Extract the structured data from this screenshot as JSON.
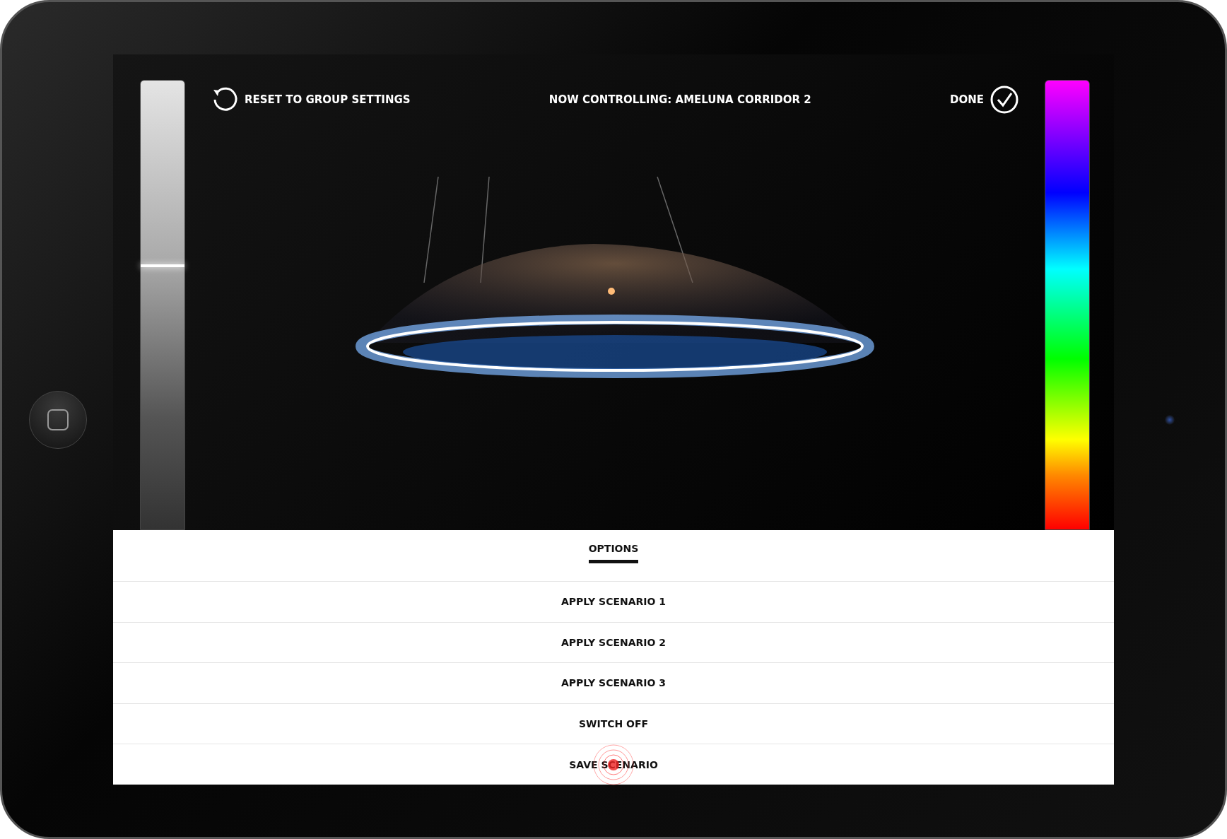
{
  "header": {
    "reset_label": "RESET TO GROUP SETTINGS",
    "title": "NOW CONTROLLING: AMELUNA CORRIDOR 2",
    "done_label": "DONE"
  },
  "brightness": {
    "level": 0.59
  },
  "options": {
    "tab": {
      "label": "OPTIONS",
      "selected": true
    },
    "items": [
      {
        "label": "APPLY SCENARIO 1",
        "tapped": false
      },
      {
        "label": "APPLY SCENARIO 2",
        "tapped": false
      },
      {
        "label": "APPLY SCENARIO 3",
        "tapped": false
      },
      {
        "label": "SWITCH OFF",
        "tapped": false
      },
      {
        "label": "SAVE SCENARIO",
        "tapped": true
      }
    ]
  }
}
